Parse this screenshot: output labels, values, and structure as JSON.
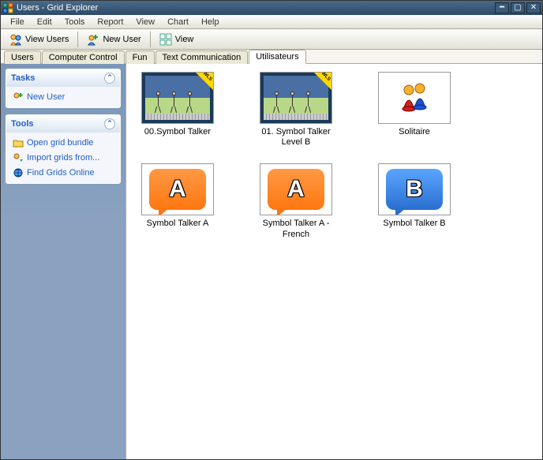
{
  "window": {
    "title": "Users - Grid Explorer"
  },
  "menubar": {
    "items": [
      {
        "label": "File"
      },
      {
        "label": "Edit"
      },
      {
        "label": "Tools"
      },
      {
        "label": "Report"
      },
      {
        "label": "View"
      },
      {
        "label": "Chart"
      },
      {
        "label": "Help"
      }
    ]
  },
  "toolbar": {
    "view_users": "View Users",
    "new_user": "New User",
    "view": "View"
  },
  "tabs": [
    {
      "label": "Users"
    },
    {
      "label": "Computer Control"
    },
    {
      "label": "Fun"
    },
    {
      "label": "Text Communication"
    },
    {
      "label": "Utilisateurs",
      "active": true
    }
  ],
  "sidebar": {
    "tasks": {
      "title": "Tasks",
      "new_user": "New User"
    },
    "tools": {
      "title": "Tools",
      "open_bundle": "Open grid bundle",
      "import_grids": "Import grids from...",
      "find_online": "Find Grids Online"
    }
  },
  "grid_items": [
    {
      "label": "00.Symbol Talker",
      "type": "scene",
      "wls": true
    },
    {
      "label": "01. Symbol Talker Level B",
      "type": "scene",
      "wls": true
    },
    {
      "label": "Solitaire",
      "type": "solitaire",
      "wls": false
    },
    {
      "label": "Symbol Talker A",
      "type": "bubbleA_orange",
      "wls": false
    },
    {
      "label": "Symbol Talker A - French",
      "type": "bubbleA_orange",
      "wls": false
    },
    {
      "label": "Symbol Talker B",
      "type": "bubbleB_blue",
      "wls": false
    }
  ]
}
